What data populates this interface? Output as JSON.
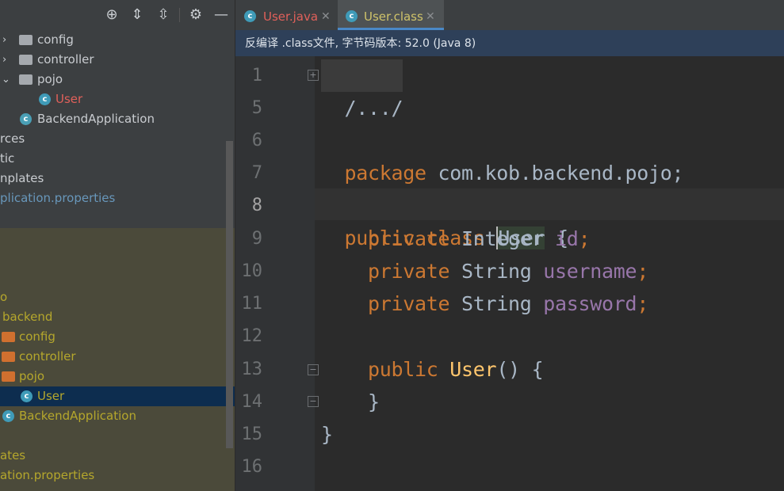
{
  "project": {
    "tree_top": [
      {
        "label": "config",
        "type": "folder",
        "expanded": false
      },
      {
        "label": "controller",
        "type": "folder",
        "expanded": false
      },
      {
        "label": "pojo",
        "type": "folder",
        "expanded": true
      },
      {
        "label": "User",
        "type": "class"
      },
      {
        "label": "BackendApplication",
        "type": "app"
      },
      {
        "label": "rces"
      },
      {
        "label": "tic"
      },
      {
        "label": "nplates"
      },
      {
        "label": "plication.properties"
      }
    ],
    "tree_bottom": [
      {
        "label": "o"
      },
      {
        "label": "backend"
      },
      {
        "label": "config",
        "type": "folder"
      },
      {
        "label": "controller",
        "type": "folder"
      },
      {
        "label": "pojo",
        "type": "folder"
      },
      {
        "label": "User",
        "type": "class",
        "selected": true
      },
      {
        "label": "BackendApplication",
        "type": "app"
      },
      {
        "label": "ates"
      },
      {
        "label": "ation.properties"
      }
    ]
  },
  "tabs": [
    {
      "label": "User.java",
      "active": false
    },
    {
      "label": "User.class",
      "active": true
    }
  ],
  "infobar": "反编译 .class文件, 字节码版本: 52.0 (Java 8)",
  "editor": {
    "line_numbers": [
      "1",
      "5",
      "6",
      "7",
      "8",
      "9",
      "10",
      "11",
      "12",
      "13",
      "14",
      "15",
      "16"
    ],
    "current_line": "8",
    "code": {
      "l1": "/.../",
      "l6_kw": "package",
      "l6_rest": " com.kob.backend.pojo;",
      "l8_kw1": "public",
      "l8_kw2": "class",
      "l8_name": "User",
      "l8_brace": " {",
      "l9_kw": "private",
      "l9_type": " Integer ",
      "l9_field": "id",
      "l10_kw": "private",
      "l10_type": " String ",
      "l10_field": "username",
      "l11_kw": "private",
      "l11_type": " String ",
      "l11_field": "password",
      "l13_kw": "public",
      "l13_fn": "User",
      "l13_rest": "() {",
      "l14": "}",
      "l15": "}",
      "semicolon": ";"
    }
  },
  "colors": {
    "keyword": "#cc7832",
    "field": "#9876aa",
    "function": "#ffc66d",
    "text": "#a9b7c6",
    "tab_active_underline": "#4a88c7"
  },
  "icons": {
    "toolbar": [
      "locate-icon",
      "expand-all-icon",
      "collapse-all-icon",
      "gear-icon",
      "minimize-icon"
    ]
  }
}
